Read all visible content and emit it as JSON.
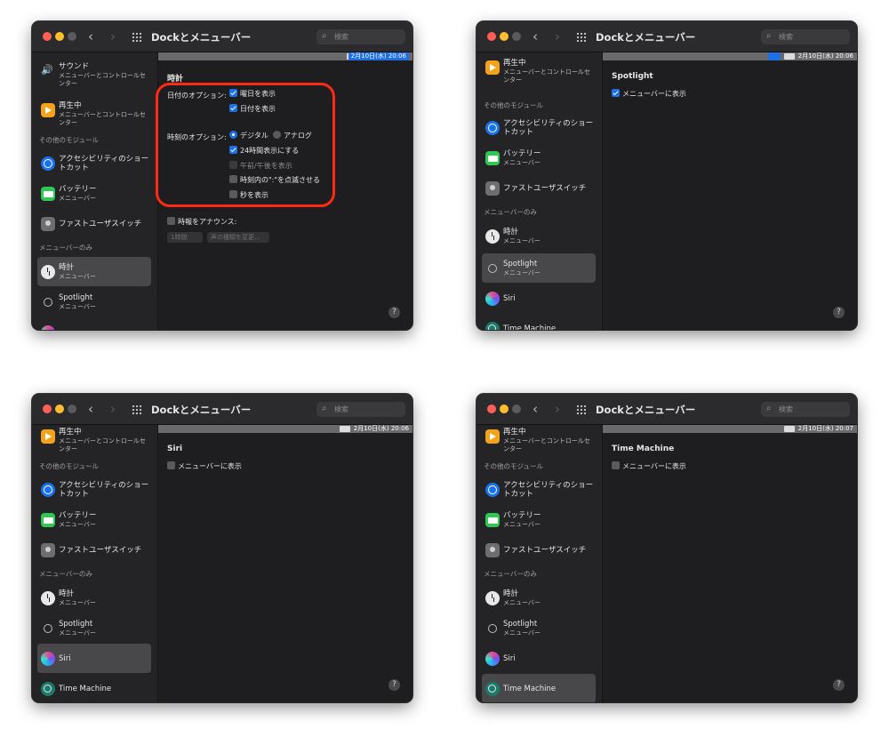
{
  "window_title": "Dockとメニューバー",
  "search_placeholder": "検索",
  "colors": {
    "accent": "#1f6fe5",
    "highlight": "#ff2a14"
  },
  "icons": {
    "back": "‹",
    "forward": "›",
    "search": "⌕",
    "help": "?"
  },
  "menubar_clock": [
    "2月10日(水) 20:06",
    "2月10日(水) 20:06",
    "2月10日(水) 20:06",
    "2月10日(水) 20:07"
  ],
  "sidebar": {
    "sound": {
      "title": "サウンド",
      "sub": "メニューバーとコントロールセンター"
    },
    "now_playing": {
      "title": "再生中",
      "sub": "メニューバーとコントロールセンター"
    },
    "section_other": "その他のモジュール",
    "accessibility": {
      "title": "アクセシビリティのショートカット"
    },
    "battery": {
      "title": "バッテリー",
      "sub": "メニューバー"
    },
    "fast_user": {
      "title": "ファストユーザスイッチ"
    },
    "section_menubar_only": "メニューバーのみ",
    "clock": {
      "title": "時計",
      "sub": "メニューバー"
    },
    "spotlight": {
      "title": "Spotlight",
      "sub": "メニューバー"
    },
    "siri": {
      "title": "Siri"
    },
    "time_machine": {
      "title": "Time Machine"
    }
  },
  "clock_panel": {
    "title": "時計",
    "date_options_label": "日付のオプション:",
    "show_weekday": "曜日を表示",
    "show_date": "日付を表示",
    "time_options_label": "時刻のオプション:",
    "digital": "デジタル",
    "analog": "アナログ",
    "use_24h": "24時間表示にする",
    "show_ampm": "午前/午後を表示",
    "flash_separators": "時刻内の\":\"を点滅させる",
    "show_seconds": "秒を表示",
    "announce_time": "時報をアナウンス:",
    "interval": "1時間",
    "change_voice": "声の種類を変更..."
  },
  "spotlight_panel": {
    "title": "Spotlight",
    "show_in_menubar": "メニューバーに表示"
  },
  "siri_panel": {
    "title": "Siri",
    "show_in_menubar": "メニューバーに表示"
  },
  "tm_panel": {
    "title": "Time Machine",
    "show_in_menubar": "メニューバーに表示"
  }
}
